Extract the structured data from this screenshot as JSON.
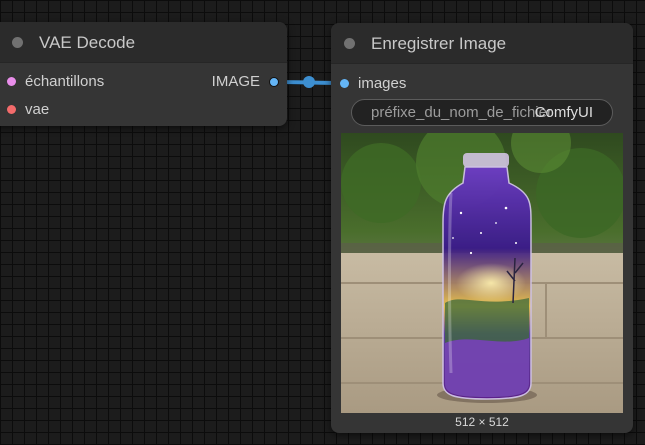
{
  "vae_decode_node": {
    "title": "VAE Decode",
    "inputs": [
      {
        "label": "échantillons",
        "color": "#e98eea"
      },
      {
        "label": "vae",
        "color": "#f36b6b"
      }
    ],
    "output": {
      "label": "IMAGE",
      "color": "#64b5f6"
    }
  },
  "save_image_node": {
    "title": "Enregistrer Image",
    "input": {
      "label": "images",
      "color": "#64b5f6"
    },
    "widget": {
      "name": "préfixe_du_nom_de_fichier",
      "value": "ComfyUI"
    },
    "preview": {
      "dimensions": "512 × 512"
    }
  },
  "link_color": "#3d8fd1"
}
